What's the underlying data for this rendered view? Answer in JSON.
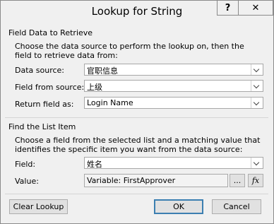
{
  "window": {
    "title": "Lookup for String",
    "help_label": "?",
    "close_label": "✕"
  },
  "retrieve": {
    "heading": "Field Data to Retrieve",
    "description": "Choose the data source to perform the lookup on, then the field to retrieve data from:",
    "data_source_label": "Data source:",
    "data_source_value": "官职信息",
    "field_from_source_label": "Field from source:",
    "field_from_source_value": "上级",
    "return_field_label": "Return field as:",
    "return_field_value": "Login Name"
  },
  "find": {
    "heading": "Find the List Item",
    "description": "Choose a field from the selected list and a matching value that identifies the specific item you want from the data source:",
    "field_label": "Field:",
    "field_value": "姓名",
    "value_label": "Value:",
    "value_value": "Variable: FirstApprover",
    "browse_label": "...",
    "fx_label": "fx"
  },
  "buttons": {
    "clear_lookup": "Clear Lookup",
    "ok": "OK",
    "cancel": "Cancel"
  }
}
